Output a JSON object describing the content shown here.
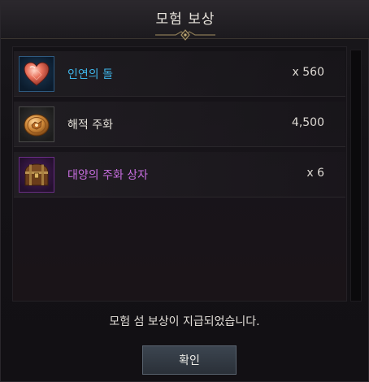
{
  "dialog": {
    "title": "모험 보상",
    "message": "모험 섬 보상이 지급되었습니다.",
    "confirm_label": "확인"
  },
  "rewards": [
    {
      "name": "인연의 돌",
      "quantity": "x 560",
      "icon": "heart-stone-icon",
      "name_color": "#3fb4e8",
      "slot_color": "blue"
    },
    {
      "name": "해적 주화",
      "quantity": "4,500",
      "icon": "pirate-coin-icon",
      "name_color": "#e6e2da",
      "slot_color": "grey"
    },
    {
      "name": "대양의 주화 상자",
      "quantity": "x 6",
      "icon": "treasure-chest-icon",
      "name_color": "#c86ee0",
      "slot_color": "purple"
    }
  ]
}
